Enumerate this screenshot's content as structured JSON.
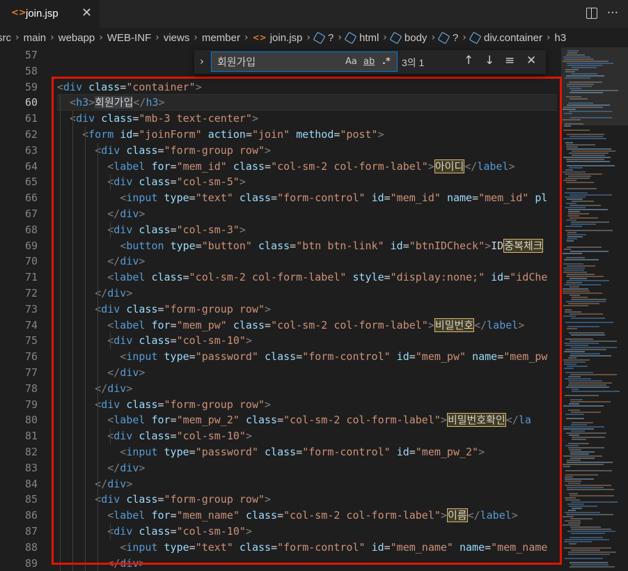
{
  "tab": {
    "icon": "code-file-icon",
    "icon_glyph": "<>",
    "name": "join.jsp",
    "close": "✕"
  },
  "tab_actions": {
    "split_icon": "split-editor-icon",
    "more_icon": "ellipsis-icon",
    "more_glyph": "···"
  },
  "breadcrumb": [
    "src",
    "main",
    "webapp",
    "WEB-INF",
    "views",
    "member",
    "join.jsp",
    "?",
    "html",
    "body",
    "?",
    "div.container",
    "h3"
  ],
  "find_widget": {
    "query": "회원가입",
    "match_case": "Aa",
    "whole_word": "ab",
    "regex": ".*",
    "count": "3의 1",
    "prev_icon": "arrow-up-icon",
    "next_icon": "arrow-down-icon",
    "selection_icon": "find-in-selection-icon",
    "close_icon": "close-icon"
  },
  "line_numbers": [
    "57",
    "58",
    "59",
    "60",
    "61",
    "62",
    "63",
    "64",
    "65",
    "66",
    "67",
    "68",
    "69",
    "70",
    "71",
    "72",
    "73",
    "74",
    "75",
    "76",
    "77",
    "78",
    "79",
    "80",
    "81",
    "82",
    "83",
    "84",
    "85",
    "86",
    "87",
    "88",
    "89"
  ],
  "active_line": "60",
  "code_lines": [
    [],
    [],
    [
      [
        "br",
        "<"
      ],
      [
        "tag",
        "div"
      ],
      [
        "t",
        " "
      ],
      [
        "attr",
        "class"
      ],
      [
        "t",
        "="
      ],
      [
        "str",
        "\"container\""
      ],
      [
        "br",
        ">"
      ]
    ],
    [
      [
        "t",
        "  "
      ],
      [
        "br",
        "<"
      ],
      [
        "tag",
        "h3"
      ],
      [
        "br",
        ">"
      ],
      [
        "sel",
        "회원가입"
      ],
      [
        "br",
        "</"
      ],
      [
        "tag",
        "h3"
      ],
      [
        "br",
        ">"
      ]
    ],
    [
      [
        "t",
        "  "
      ],
      [
        "br",
        "<"
      ],
      [
        "tag",
        "div"
      ],
      [
        "t",
        " "
      ],
      [
        "attr",
        "class"
      ],
      [
        "t",
        "="
      ],
      [
        "str",
        "\"mb-3 text-center\""
      ],
      [
        "br",
        ">"
      ]
    ],
    [
      [
        "t",
        "    "
      ],
      [
        "br",
        "<"
      ],
      [
        "tag",
        "form"
      ],
      [
        "t",
        " "
      ],
      [
        "attr",
        "id"
      ],
      [
        "t",
        "="
      ],
      [
        "str",
        "\"joinForm\""
      ],
      [
        "t",
        " "
      ],
      [
        "attr",
        "action"
      ],
      [
        "t",
        "="
      ],
      [
        "str",
        "\"join\""
      ],
      [
        "t",
        " "
      ],
      [
        "attr",
        "method"
      ],
      [
        "t",
        "="
      ],
      [
        "str",
        "\"post\""
      ],
      [
        "br",
        ">"
      ]
    ],
    [
      [
        "t",
        "      "
      ],
      [
        "br",
        "<"
      ],
      [
        "tag",
        "div"
      ],
      [
        "t",
        " "
      ],
      [
        "attr",
        "class"
      ],
      [
        "t",
        "="
      ],
      [
        "str",
        "\"form-group row\""
      ],
      [
        "br",
        ">"
      ]
    ],
    [
      [
        "t",
        "        "
      ],
      [
        "br",
        "<"
      ],
      [
        "tag",
        "label"
      ],
      [
        "t",
        " "
      ],
      [
        "attr",
        "for"
      ],
      [
        "t",
        "="
      ],
      [
        "str",
        "\"mem_id\""
      ],
      [
        "t",
        " "
      ],
      [
        "attr",
        "class"
      ],
      [
        "t",
        "="
      ],
      [
        "str",
        "\"col-sm-2 col-form-label\""
      ],
      [
        "br",
        ">"
      ],
      [
        "hl",
        "아이디"
      ],
      [
        "br",
        "</"
      ],
      [
        "tag",
        "label"
      ],
      [
        "br",
        ">"
      ]
    ],
    [
      [
        "t",
        "        "
      ],
      [
        "br",
        "<"
      ],
      [
        "tag",
        "div"
      ],
      [
        "t",
        " "
      ],
      [
        "attr",
        "class"
      ],
      [
        "t",
        "="
      ],
      [
        "str",
        "\"col-sm-5\""
      ],
      [
        "br",
        ">"
      ]
    ],
    [
      [
        "t",
        "          "
      ],
      [
        "br",
        "<"
      ],
      [
        "tag",
        "input"
      ],
      [
        "t",
        " "
      ],
      [
        "attr",
        "type"
      ],
      [
        "t",
        "="
      ],
      [
        "str",
        "\"text\""
      ],
      [
        "t",
        " "
      ],
      [
        "attr",
        "class"
      ],
      [
        "t",
        "="
      ],
      [
        "str",
        "\"form-control\""
      ],
      [
        "t",
        " "
      ],
      [
        "attr",
        "id"
      ],
      [
        "t",
        "="
      ],
      [
        "str",
        "\"mem_id\""
      ],
      [
        "t",
        " "
      ],
      [
        "attr",
        "name"
      ],
      [
        "t",
        "="
      ],
      [
        "str",
        "\"mem_id\""
      ],
      [
        "t",
        " "
      ],
      [
        "attr",
        "pl"
      ]
    ],
    [
      [
        "t",
        "        "
      ],
      [
        "br",
        "</"
      ],
      [
        "tag",
        "div"
      ],
      [
        "br",
        ">"
      ]
    ],
    [
      [
        "t",
        "        "
      ],
      [
        "br",
        "<"
      ],
      [
        "tag",
        "div"
      ],
      [
        "t",
        " "
      ],
      [
        "attr",
        "class"
      ],
      [
        "t",
        "="
      ],
      [
        "str",
        "\"col-sm-3\""
      ],
      [
        "br",
        ">"
      ]
    ],
    [
      [
        "t",
        "          "
      ],
      [
        "br",
        "<"
      ],
      [
        "tag",
        "button"
      ],
      [
        "t",
        " "
      ],
      [
        "attr",
        "type"
      ],
      [
        "t",
        "="
      ],
      [
        "str",
        "\"button\""
      ],
      [
        "t",
        " "
      ],
      [
        "attr",
        "class"
      ],
      [
        "t",
        "="
      ],
      [
        "str",
        "\"btn btn-link\""
      ],
      [
        "t",
        " "
      ],
      [
        "attr",
        "id"
      ],
      [
        "t",
        "="
      ],
      [
        "str",
        "\"btnIDCheck\""
      ],
      [
        "br",
        ">"
      ],
      [
        "t",
        "ID"
      ],
      [
        "hl",
        "중복체크"
      ]
    ],
    [
      [
        "t",
        "        "
      ],
      [
        "br",
        "</"
      ],
      [
        "tag",
        "div"
      ],
      [
        "br",
        ">"
      ]
    ],
    [
      [
        "t",
        "        "
      ],
      [
        "br",
        "<"
      ],
      [
        "tag",
        "label"
      ],
      [
        "t",
        " "
      ],
      [
        "attr",
        "class"
      ],
      [
        "t",
        "="
      ],
      [
        "str",
        "\"col-sm-2 col-form-label\""
      ],
      [
        "t",
        " "
      ],
      [
        "attr",
        "style"
      ],
      [
        "t",
        "="
      ],
      [
        "str",
        "\"display:none;\""
      ],
      [
        "t",
        " "
      ],
      [
        "attr",
        "id"
      ],
      [
        "t",
        "="
      ],
      [
        "str",
        "\"idChe"
      ]
    ],
    [
      [
        "t",
        "      "
      ],
      [
        "br",
        "</"
      ],
      [
        "tag",
        "div"
      ],
      [
        "br",
        ">"
      ]
    ],
    [
      [
        "t",
        "      "
      ],
      [
        "br",
        "<"
      ],
      [
        "tag",
        "div"
      ],
      [
        "t",
        " "
      ],
      [
        "attr",
        "class"
      ],
      [
        "t",
        "="
      ],
      [
        "str",
        "\"form-group row\""
      ],
      [
        "br",
        ">"
      ]
    ],
    [
      [
        "t",
        "        "
      ],
      [
        "br",
        "<"
      ],
      [
        "tag",
        "label"
      ],
      [
        "t",
        " "
      ],
      [
        "attr",
        "for"
      ],
      [
        "t",
        "="
      ],
      [
        "str",
        "\"mem_pw\""
      ],
      [
        "t",
        " "
      ],
      [
        "attr",
        "class"
      ],
      [
        "t",
        "="
      ],
      [
        "str",
        "\"col-sm-2 col-form-label\""
      ],
      [
        "br",
        ">"
      ],
      [
        "hl",
        "비밀번호"
      ],
      [
        "br",
        "</"
      ],
      [
        "tag",
        "label"
      ],
      [
        "br",
        ">"
      ]
    ],
    [
      [
        "t",
        "        "
      ],
      [
        "br",
        "<"
      ],
      [
        "tag",
        "div"
      ],
      [
        "t",
        " "
      ],
      [
        "attr",
        "class"
      ],
      [
        "t",
        "="
      ],
      [
        "str",
        "\"col-sm-10\""
      ],
      [
        "br",
        ">"
      ]
    ],
    [
      [
        "t",
        "          "
      ],
      [
        "br",
        "<"
      ],
      [
        "tag",
        "input"
      ],
      [
        "t",
        " "
      ],
      [
        "attr",
        "type"
      ],
      [
        "t",
        "="
      ],
      [
        "str",
        "\"password\""
      ],
      [
        "t",
        " "
      ],
      [
        "attr",
        "class"
      ],
      [
        "t",
        "="
      ],
      [
        "str",
        "\"form-control\""
      ],
      [
        "t",
        " "
      ],
      [
        "attr",
        "id"
      ],
      [
        "t",
        "="
      ],
      [
        "str",
        "\"mem_pw\""
      ],
      [
        "t",
        " "
      ],
      [
        "attr",
        "name"
      ],
      [
        "t",
        "="
      ],
      [
        "str",
        "\"mem_pw"
      ]
    ],
    [
      [
        "t",
        "        "
      ],
      [
        "br",
        "</"
      ],
      [
        "tag",
        "div"
      ],
      [
        "br",
        ">"
      ]
    ],
    [
      [
        "t",
        "      "
      ],
      [
        "br",
        "</"
      ],
      [
        "tag",
        "div"
      ],
      [
        "br",
        ">"
      ]
    ],
    [
      [
        "t",
        "      "
      ],
      [
        "br",
        "<"
      ],
      [
        "tag",
        "div"
      ],
      [
        "t",
        " "
      ],
      [
        "attr",
        "class"
      ],
      [
        "t",
        "="
      ],
      [
        "str",
        "\"form-group row\""
      ],
      [
        "br",
        ">"
      ]
    ],
    [
      [
        "t",
        "        "
      ],
      [
        "br",
        "<"
      ],
      [
        "tag",
        "label"
      ],
      [
        "t",
        " "
      ],
      [
        "attr",
        "for"
      ],
      [
        "t",
        "="
      ],
      [
        "str",
        "\"mem_pw_2\""
      ],
      [
        "t",
        " "
      ],
      [
        "attr",
        "class"
      ],
      [
        "t",
        "="
      ],
      [
        "str",
        "\"col-sm-2 col-form-label\""
      ],
      [
        "br",
        ">"
      ],
      [
        "hl",
        "비밀번호확인"
      ],
      [
        "br",
        "</"
      ],
      [
        "tag",
        "la"
      ]
    ],
    [
      [
        "t",
        "        "
      ],
      [
        "br",
        "<"
      ],
      [
        "tag",
        "div"
      ],
      [
        "t",
        " "
      ],
      [
        "attr",
        "class"
      ],
      [
        "t",
        "="
      ],
      [
        "str",
        "\"col-sm-10\""
      ],
      [
        "br",
        ">"
      ]
    ],
    [
      [
        "t",
        "          "
      ],
      [
        "br",
        "<"
      ],
      [
        "tag",
        "input"
      ],
      [
        "t",
        " "
      ],
      [
        "attr",
        "type"
      ],
      [
        "t",
        "="
      ],
      [
        "str",
        "\"password\""
      ],
      [
        "t",
        " "
      ],
      [
        "attr",
        "class"
      ],
      [
        "t",
        "="
      ],
      [
        "str",
        "\"form-control\""
      ],
      [
        "t",
        " "
      ],
      [
        "attr",
        "id"
      ],
      [
        "t",
        "="
      ],
      [
        "str",
        "\"mem_pw_2\""
      ],
      [
        "br",
        ">"
      ]
    ],
    [
      [
        "t",
        "        "
      ],
      [
        "br",
        "</"
      ],
      [
        "tag",
        "div"
      ],
      [
        "br",
        ">"
      ]
    ],
    [
      [
        "t",
        "      "
      ],
      [
        "br",
        "</"
      ],
      [
        "tag",
        "div"
      ],
      [
        "br",
        ">"
      ]
    ],
    [
      [
        "t",
        "      "
      ],
      [
        "br",
        "<"
      ],
      [
        "tag",
        "div"
      ],
      [
        "t",
        " "
      ],
      [
        "attr",
        "class"
      ],
      [
        "t",
        "="
      ],
      [
        "str",
        "\"form-group row\""
      ],
      [
        "br",
        ">"
      ]
    ],
    [
      [
        "t",
        "        "
      ],
      [
        "br",
        "<"
      ],
      [
        "tag",
        "label"
      ],
      [
        "t",
        " "
      ],
      [
        "attr",
        "for"
      ],
      [
        "t",
        "="
      ],
      [
        "str",
        "\"mem_name\""
      ],
      [
        "t",
        " "
      ],
      [
        "attr",
        "class"
      ],
      [
        "t",
        "="
      ],
      [
        "str",
        "\"col-sm-2 col-form-label\""
      ],
      [
        "br",
        ">"
      ],
      [
        "hl",
        "이름"
      ],
      [
        "br",
        "</"
      ],
      [
        "tag",
        "label"
      ],
      [
        "br",
        ">"
      ]
    ],
    [
      [
        "t",
        "        "
      ],
      [
        "br",
        "<"
      ],
      [
        "tag",
        "div"
      ],
      [
        "t",
        " "
      ],
      [
        "attr",
        "class"
      ],
      [
        "t",
        "="
      ],
      [
        "str",
        "\"col-sm-10\""
      ],
      [
        "br",
        ">"
      ]
    ],
    [
      [
        "t",
        "          "
      ],
      [
        "br",
        "<"
      ],
      [
        "tag",
        "input"
      ],
      [
        "t",
        " "
      ],
      [
        "attr",
        "type"
      ],
      [
        "t",
        "="
      ],
      [
        "str",
        "\"text\""
      ],
      [
        "t",
        " "
      ],
      [
        "attr",
        "class"
      ],
      [
        "t",
        "="
      ],
      [
        "str",
        "\"form-control\""
      ],
      [
        "t",
        " "
      ],
      [
        "attr",
        "id"
      ],
      [
        "t",
        "="
      ],
      [
        "str",
        "\"mem_name\""
      ],
      [
        "t",
        " "
      ],
      [
        "attr",
        "name"
      ],
      [
        "t",
        "="
      ],
      [
        "str",
        "\"mem_name"
      ]
    ],
    [
      [
        "t",
        "        "
      ],
      [
        "br",
        "</"
      ],
      [
        "tag",
        "div"
      ],
      [
        "br",
        ">"
      ]
    ]
  ],
  "colors": {
    "tag": "#569cd6",
    "attr": "#9cdcfe",
    "string": "#ce9178",
    "bracket": "#808080",
    "highlight_border": "#d7ba7d",
    "annotation_box": "#e51400",
    "find_focus": "#007fd4"
  }
}
